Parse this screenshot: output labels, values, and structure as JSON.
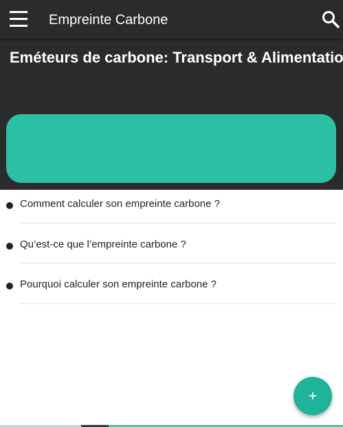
{
  "app_bar": {
    "title": "Empreinte Carbone",
    "menu_icon": "menu-icon",
    "search_icon": "search-icon"
  },
  "header": {
    "section_title": "Eméteurs de carbone:  Transport & Alimentation",
    "banner_color": "#2bc0a5"
  },
  "faq": {
    "items": [
      {
        "label": "Comment calculer son empreinte carbone ?"
      },
      {
        "label": "Qu’est-ce que l’empreinte carbone ?"
      },
      {
        "label": "Pourquoi calculer son empreinte carbone ?"
      }
    ]
  },
  "fab": {
    "icon": "+",
    "icon_name": "plus-icon",
    "color": "#1fb39a"
  }
}
